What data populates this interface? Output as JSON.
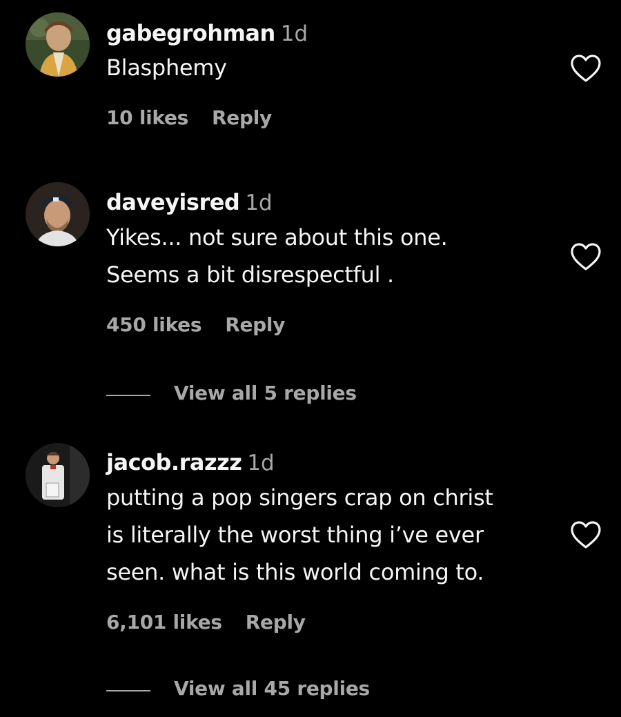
{
  "colors": {
    "background": "#000000",
    "primary_text": "#f5f5f5",
    "secondary_text": "#a8a8a8"
  },
  "comments": [
    {
      "username": "gabegrohman",
      "time": "1d",
      "text_lines": [
        "Blasphemy"
      ],
      "likes": "10 likes",
      "reply_label": "Reply",
      "avatar_icon": "user-avatar",
      "like_icon": "heart-outline-icon"
    },
    {
      "username": "daveyisred",
      "time": "1d",
      "text_lines": [
        "Yikes... not sure about this one.",
        "Seems a bit disrespectful ."
      ],
      "likes": "450 likes",
      "reply_label": "Reply",
      "view_replies": "View all 5 replies",
      "avatar_icon": "user-avatar",
      "like_icon": "heart-outline-icon"
    },
    {
      "username": "jacob.razzz",
      "time": "1d",
      "text_lines": [
        "putting a pop singers crap on christ",
        "is literally the worst thing i’ve ever",
        "seen. what is this world coming to."
      ],
      "likes": "6,101 likes",
      "reply_label": "Reply",
      "view_replies": "View all 45 replies",
      "avatar_icon": "user-avatar",
      "like_icon": "heart-outline-icon"
    }
  ]
}
